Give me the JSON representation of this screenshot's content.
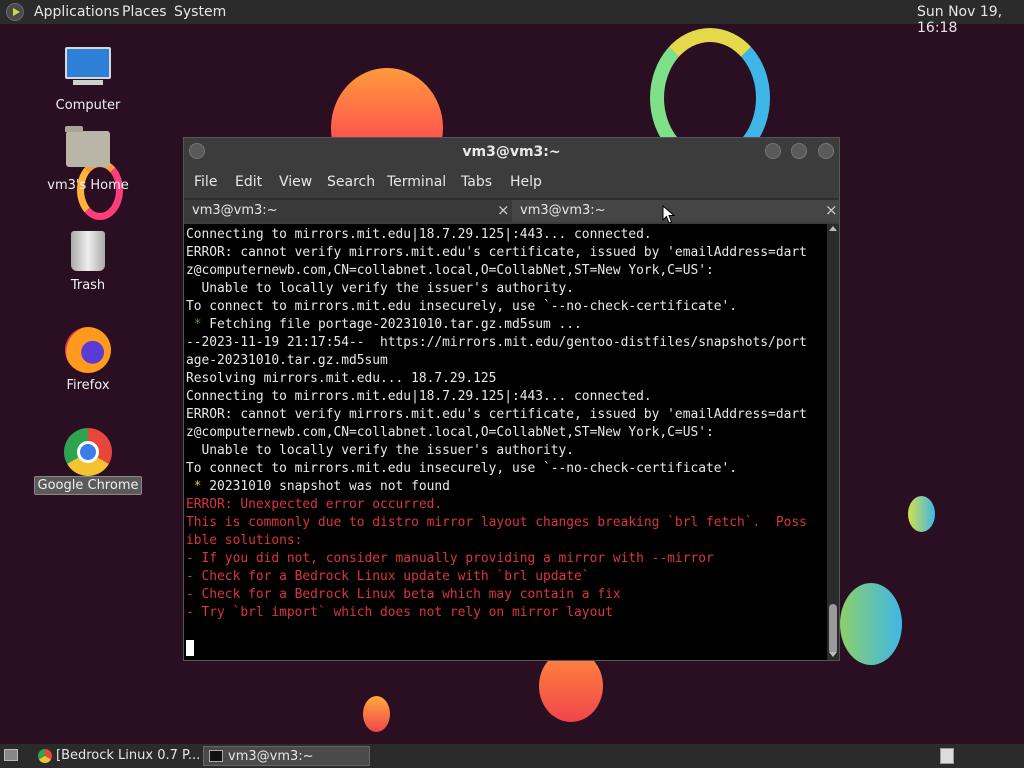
{
  "top_panel": {
    "menus": [
      "Applications",
      "Places",
      "System"
    ],
    "clock": "Sun Nov 19, 16:18"
  },
  "desktop": {
    "icons": [
      {
        "label": "Computer",
        "icon": "computer-icon"
      },
      {
        "label": "vm3's Home",
        "icon": "home-folder-icon"
      },
      {
        "label": "Trash",
        "icon": "trash-icon"
      },
      {
        "label": "Firefox",
        "icon": "firefox-icon"
      },
      {
        "label": "Google Chrome",
        "icon": "chrome-icon",
        "selected": true
      }
    ]
  },
  "terminal": {
    "title": "vm3@vm3:~",
    "menu": [
      "File",
      "Edit",
      "View",
      "Search",
      "Terminal",
      "Tabs",
      "Help"
    ],
    "tabs": [
      {
        "label": "vm3@vm3:~",
        "close": "×"
      },
      {
        "label": "vm3@vm3:~",
        "close": "×"
      }
    ],
    "lines": [
      {
        "text": "Connecting to mirrors.mit.edu|18.7.29.125|:443... connected.",
        "style": "normal"
      },
      {
        "text": "ERROR: cannot verify mirrors.mit.edu's certificate, issued by 'emailAddress=dart",
        "style": "normal"
      },
      {
        "text": "z@computernewb.com,CN=collabnet.local,O=CollabNet,ST=New York,C=US':",
        "style": "normal"
      },
      {
        "text": "  Unable to locally verify the issuer's authority.",
        "style": "normal"
      },
      {
        "text": "To connect to mirrors.mit.edu insecurely, use `--no-check-certificate'.",
        "style": "normal"
      },
      {
        "bullet": " * ",
        "bullet_color": "green",
        "text": "Fetching file portage-20231010.tar.gz.md5sum ...",
        "style": "normal"
      },
      {
        "text": "--2023-11-19 21:17:54--  https://mirrors.mit.edu/gentoo-distfiles/snapshots/port",
        "style": "normal"
      },
      {
        "text": "age-20231010.tar.gz.md5sum",
        "style": "normal"
      },
      {
        "text": "Resolving mirrors.mit.edu... 18.7.29.125",
        "style": "normal"
      },
      {
        "text": "Connecting to mirrors.mit.edu|18.7.29.125|:443... connected.",
        "style": "normal"
      },
      {
        "text": "ERROR: cannot verify mirrors.mit.edu's certificate, issued by 'emailAddress=dart",
        "style": "normal"
      },
      {
        "text": "z@computernewb.com,CN=collabnet.local,O=CollabNet,ST=New York,C=US':",
        "style": "normal"
      },
      {
        "text": "  Unable to locally verify the issuer's authority.",
        "style": "normal"
      },
      {
        "text": "To connect to mirrors.mit.edu insecurely, use `--no-check-certificate'.",
        "style": "normal"
      },
      {
        "bullet": " * ",
        "bullet_color": "yellow",
        "text": "20231010 snapshot was not found",
        "style": "normal"
      },
      {
        "text": "ERROR: Unexpected error occurred.",
        "style": "red"
      },
      {
        "text": "This is commonly due to distro mirror layout changes breaking `brl fetch`.  Poss",
        "style": "red"
      },
      {
        "text": "ible solutions:",
        "style": "red"
      },
      {
        "text": "- If you did not, consider manually providing a mirror with --mirror",
        "style": "red"
      },
      {
        "text": "- Check for a Bedrock Linux update with `brl update`",
        "style": "red"
      },
      {
        "text": "- Check for a Bedrock Linux beta which may contain a fix",
        "style": "red"
      },
      {
        "text": "- Try `brl import` which does not rely on mirror layout",
        "style": "red"
      }
    ]
  },
  "taskbar": {
    "tasks": [
      {
        "label": "[Bedrock Linux 0.7 P...",
        "icon": "chrome-icon"
      },
      {
        "label": "vm3@vm3:~",
        "icon": "terminal-icon",
        "active": true
      }
    ]
  },
  "colors": {
    "wallpaper": "#2a0f22",
    "panel": "#2b2b2b",
    "terminal_bg": "#000000",
    "terminal_fg": "#e8e8e8",
    "error_red": "#d9363e",
    "bullet_green": "#3aa835",
    "bullet_yellow": "#e3c02a"
  }
}
